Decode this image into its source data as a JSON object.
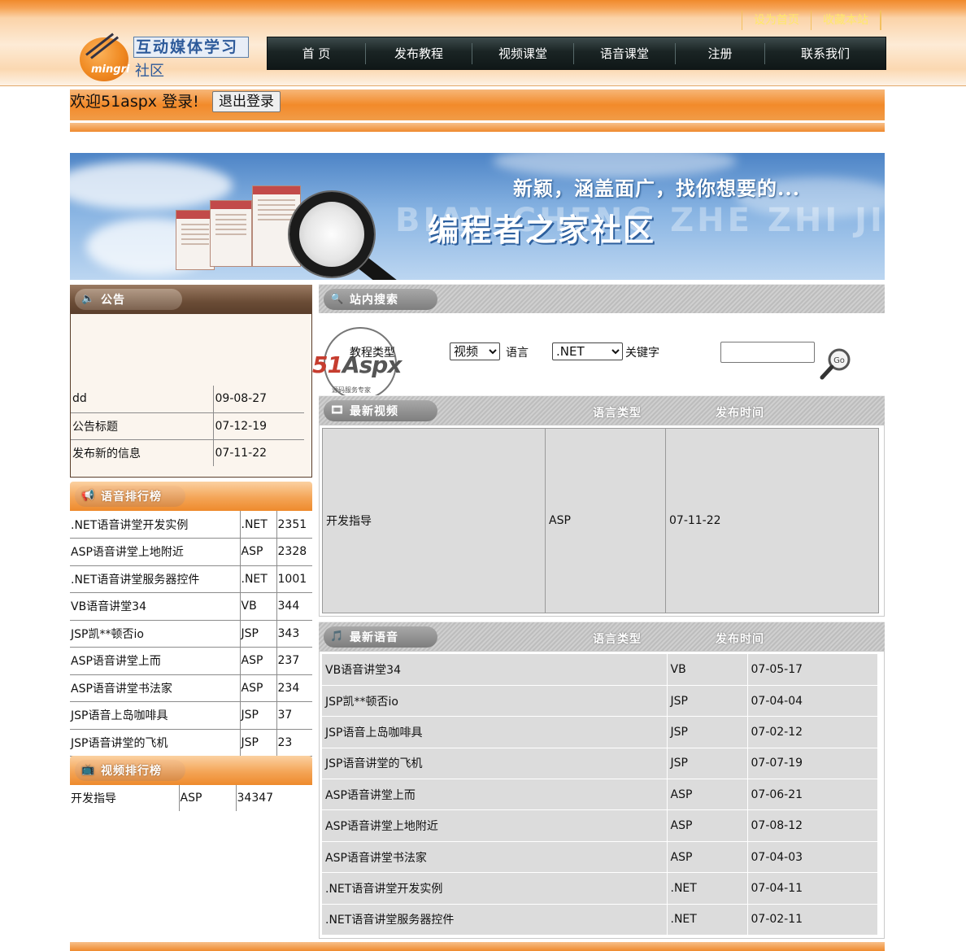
{
  "header": {
    "toplinks": [
      "设为首页",
      "收藏本站"
    ],
    "logo": {
      "title": "互动媒体学习",
      "subtitle": "社区",
      "brand": "mingri"
    },
    "nav": [
      "首 页",
      "发布教程",
      "视频课堂",
      "语音课堂",
      "注册",
      "联系我们"
    ]
  },
  "welcome": {
    "text": "欢迎51aspx 登录!",
    "logout_label": "退出登录"
  },
  "banner": {
    "slogan": "新颖，涵盖面广，找你想要的...",
    "title": "编程者之家社区",
    "pinyin": "BIAN CHENG ZHE ZHI JIA"
  },
  "notice": {
    "heading": "公告",
    "rows": [
      {
        "title": "dd",
        "date": "09-08-27"
      },
      {
        "title": "公告标题",
        "date": "07-12-19"
      },
      {
        "title": "发布新的信息",
        "date": "07-11-22"
      }
    ]
  },
  "voice_rank": {
    "heading": "语音排行榜",
    "rows": [
      {
        "title": ".NET语音讲堂开发实例",
        "lang": ".NET",
        "count": "2351"
      },
      {
        "title": "ASP语音讲堂上地附近",
        "lang": "ASP",
        "count": "2328"
      },
      {
        "title": ".NET语音讲堂服务器控件",
        "lang": ".NET",
        "count": "1001"
      },
      {
        "title": "VB语音讲堂34",
        "lang": "VB",
        "count": "344"
      },
      {
        "title": "JSP凯**顿否io",
        "lang": "JSP",
        "count": "343"
      },
      {
        "title": "ASP语音讲堂上而",
        "lang": "ASP",
        "count": "237"
      },
      {
        "title": "ASP语音讲堂书法家",
        "lang": "ASP",
        "count": "234"
      },
      {
        "title": "JSP语音上岛咖啡具",
        "lang": "JSP",
        "count": "37"
      },
      {
        "title": "JSP语音讲堂的飞机",
        "lang": "JSP",
        "count": "23"
      }
    ]
  },
  "video_rank": {
    "heading": "视频排行榜",
    "rows": [
      {
        "title": "开发指导",
        "lang": "ASP",
        "count": "34347"
      }
    ]
  },
  "search": {
    "heading": "站内搜索",
    "type_label": "教程类型",
    "type_value": "视频",
    "lang_label": "语言",
    "lang_value": ".NET",
    "keyword_label": "关键字",
    "keyword_value": "",
    "go_label": "Go",
    "watermark": {
      "brand_a": "51",
      "brand_b": "Aspx",
      "sub": "源码服务专家"
    }
  },
  "latest_video": {
    "heading": "最新视频",
    "col_lang": "语言类型",
    "col_time": "发布时间",
    "rows": [
      {
        "title": "开发指导",
        "lang": "ASP",
        "date": "07-11-22"
      }
    ]
  },
  "latest_voice": {
    "heading": "最新语音",
    "col_lang": "语言类型",
    "col_time": "发布时间",
    "rows": [
      {
        "title": "VB语音讲堂34",
        "lang": "VB",
        "date": "07-05-17"
      },
      {
        "title": "JSP凯**顿否io",
        "lang": "JSP",
        "date": "07-04-04"
      },
      {
        "title": "JSP语音上岛咖啡具",
        "lang": "JSP",
        "date": "07-02-12"
      },
      {
        "title": "JSP语音讲堂的飞机",
        "lang": "JSP",
        "date": "07-07-19"
      },
      {
        "title": "ASP语音讲堂上而",
        "lang": "ASP",
        "date": "07-06-21"
      },
      {
        "title": "ASP语音讲堂上地附近",
        "lang": "ASP",
        "date": "07-08-12"
      },
      {
        "title": "ASP语音讲堂书法家",
        "lang": "ASP",
        "date": "07-04-03"
      },
      {
        "title": ".NET语音讲堂开发实例",
        "lang": ".NET",
        "date": "07-04-11"
      },
      {
        "title": ".NET语音讲堂服务器控件",
        "lang": ".NET",
        "date": "07-02-11"
      }
    ]
  },
  "colors": {
    "accent_orange": "#f28a2a",
    "nav_dark": "#1a2424",
    "table_grey": "#dcdcdc",
    "link_yellow": "#ffe86a"
  }
}
